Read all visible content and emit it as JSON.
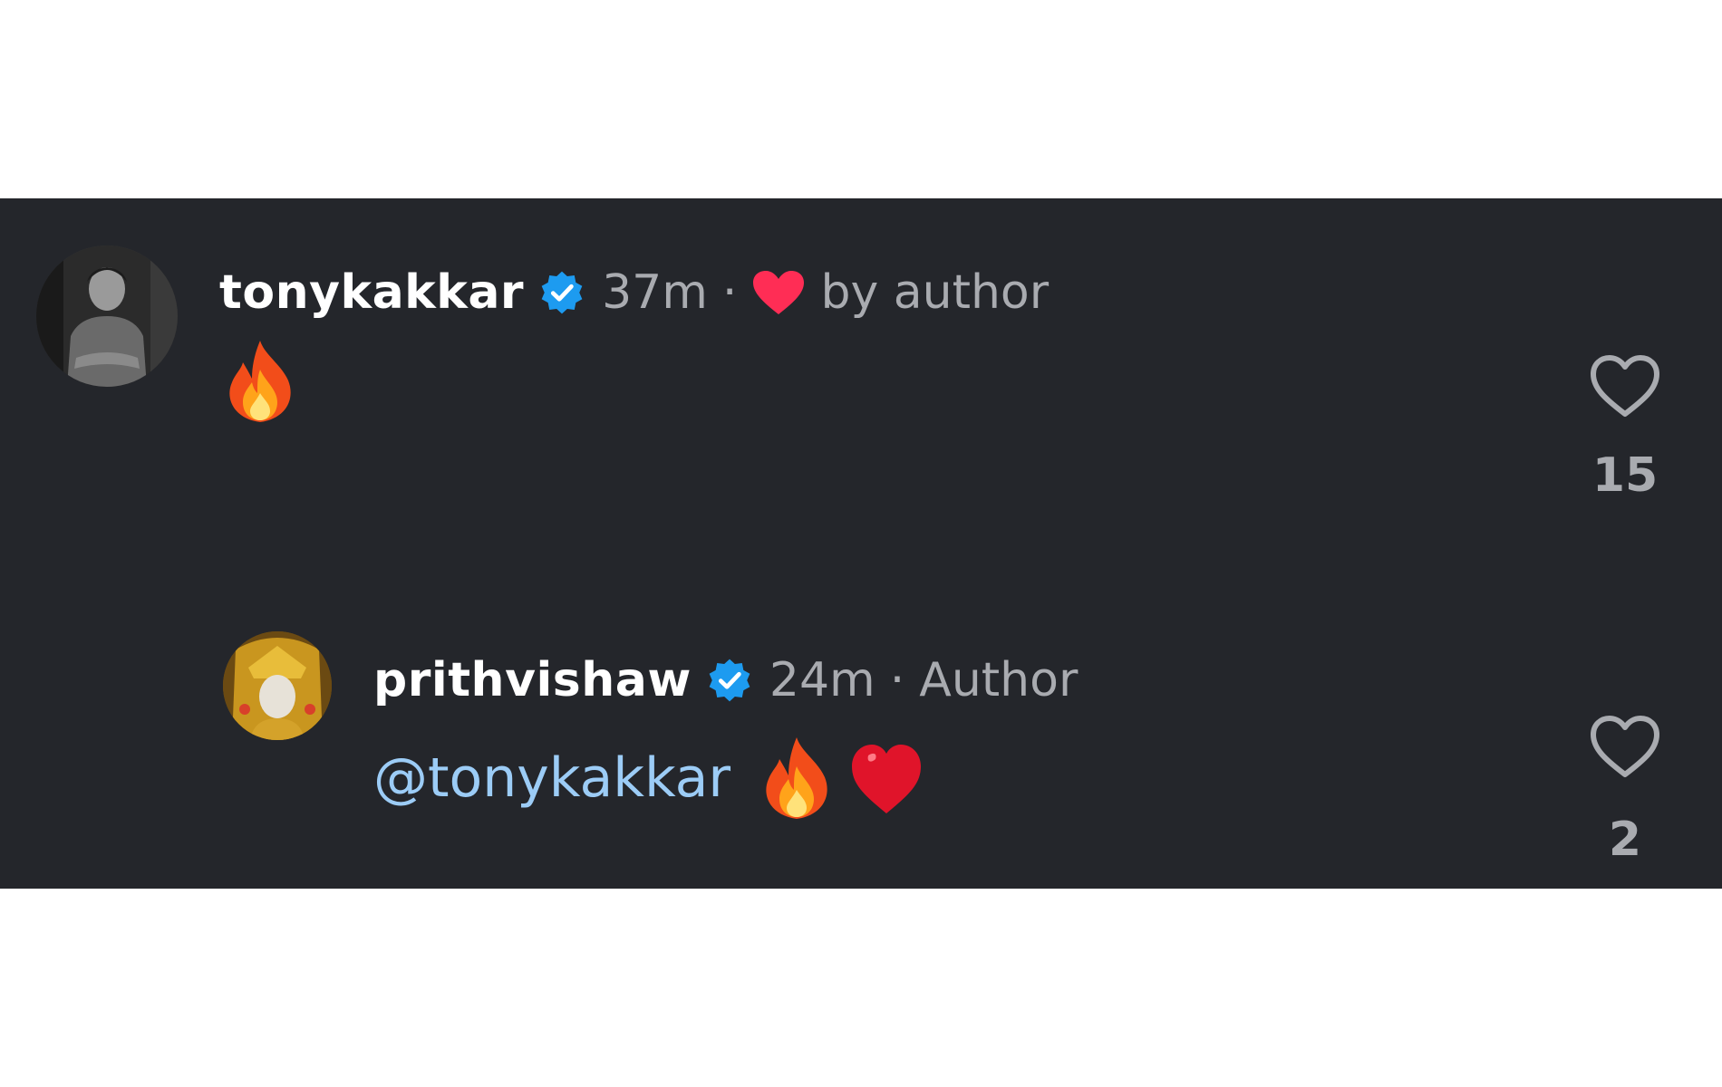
{
  "colors": {
    "panel_bg": "#24262b",
    "username": "#ffffff",
    "meta_text": "#a9abb0",
    "mention": "#9cccf6",
    "verified_badge": "#1d9bf0",
    "author_heart": "#ff2d55"
  },
  "comments": [
    {
      "username": "tonykakkar",
      "verified": true,
      "time": "37m",
      "separator": "·",
      "author_like_label": "by author",
      "body_mention": "",
      "body_emojis": [
        "fire-emoji"
      ],
      "like_count": "15",
      "avatar_icon": "user-photo-avatar"
    },
    {
      "username": "prithvishaw",
      "verified": true,
      "time": "24m",
      "separator": "·",
      "role_label": "Author",
      "body_mention": "@tonykakkar",
      "body_emojis": [
        "fire-emoji",
        "red-heart-emoji"
      ],
      "like_count": "2",
      "avatar_icon": "golden-idol-avatar"
    }
  ]
}
